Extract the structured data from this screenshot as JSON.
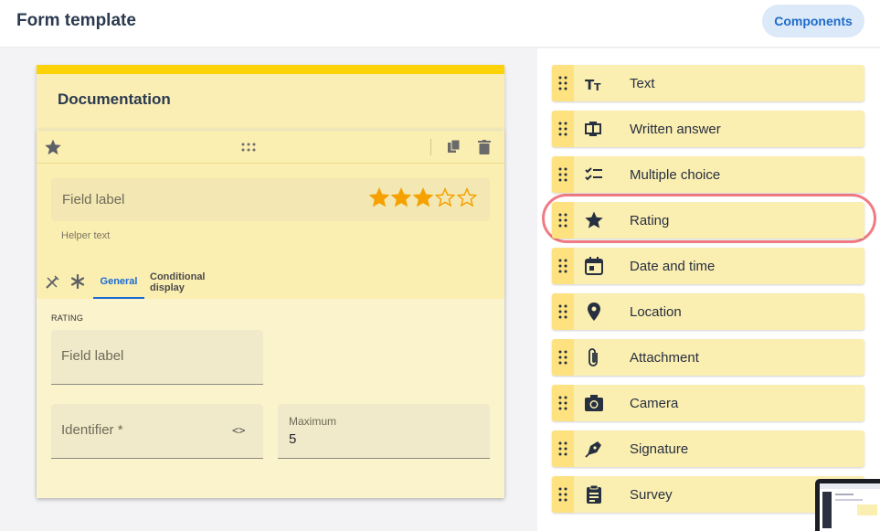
{
  "header": {
    "title": "Form template",
    "components_button": "Components"
  },
  "form": {
    "title": "Documentation",
    "field": {
      "preview_label": "Field label",
      "helper_text": "Helper text",
      "rating_filled": 3,
      "rating_max": 5,
      "tabs": [
        {
          "label": "General",
          "active": true
        },
        {
          "label": "Conditional display",
          "active": false
        }
      ],
      "section_caption": "RATING",
      "inputs": {
        "field_label_placeholder": "Field label",
        "identifier_placeholder": "Identifier *",
        "identifier_code_icon": "<>",
        "maximum_label": "Maximum",
        "maximum_value": "5"
      }
    }
  },
  "components": [
    {
      "label": "Text",
      "icon": "text-icon"
    },
    {
      "label": "Written answer",
      "icon": "written-answer-icon"
    },
    {
      "label": "Multiple choice",
      "icon": "multiple-choice-icon"
    },
    {
      "label": "Rating",
      "icon": "star-icon",
      "highlighted": true
    },
    {
      "label": "Date and time",
      "icon": "calendar-icon"
    },
    {
      "label": "Location",
      "icon": "location-pin-icon"
    },
    {
      "label": "Attachment",
      "icon": "paperclip-icon"
    },
    {
      "label": "Camera",
      "icon": "camera-icon"
    },
    {
      "label": "Signature",
      "icon": "pen-nib-icon"
    },
    {
      "label": "Survey",
      "icon": "clipboard-icon"
    }
  ],
  "colors": {
    "accent": "#1a6ad4",
    "card_yellow": "#fbeeb1",
    "strip_yellow": "#fdd206",
    "star_orange": "#f5a100",
    "highlight_ring": "#f17b83"
  }
}
